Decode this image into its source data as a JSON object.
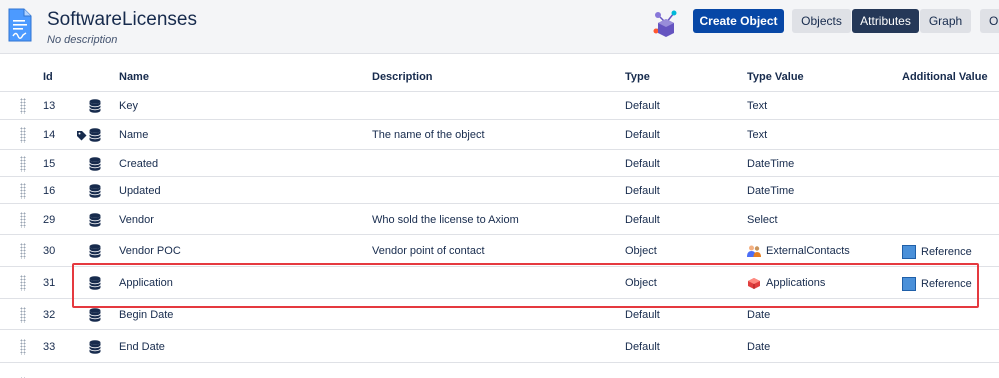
{
  "header": {
    "title": "SoftwareLicenses",
    "subtitle": "No description",
    "create_button": "Create Object",
    "tabs": [
      {
        "label": "Objects",
        "active": false
      },
      {
        "label": "Attributes",
        "active": true
      },
      {
        "label": "Graph",
        "active": false
      },
      {
        "label": "O",
        "active": false
      }
    ]
  },
  "table": {
    "columns": {
      "id": "Id",
      "name": "Name",
      "description": "Description",
      "type": "Type",
      "type_value": "Type Value",
      "additional_value": "Additional Value"
    },
    "rows": [
      {
        "id": "13",
        "name": "Key",
        "description": "",
        "type": "Default",
        "type_value": "Text",
        "additional_value": ""
      },
      {
        "id": "14",
        "name": "Name",
        "description": "The name of the object",
        "type": "Default",
        "type_value": "Text",
        "additional_value": "",
        "label_icon": "tag-icon"
      },
      {
        "id": "15",
        "name": "Created",
        "description": "",
        "type": "Default",
        "type_value": "DateTime",
        "additional_value": ""
      },
      {
        "id": "16",
        "name": "Updated",
        "description": "",
        "type": "Default",
        "type_value": "DateTime",
        "additional_value": ""
      },
      {
        "id": "29",
        "name": "Vendor",
        "description": "Who sold the license to Axiom",
        "type": "Default",
        "type_value": "Select",
        "additional_value": ""
      },
      {
        "id": "30",
        "name": "Vendor POC",
        "description": "Vendor point of contact",
        "type": "Object",
        "type_value": "ExternalContacts",
        "type_value_icon": "contacts-icon",
        "additional_value": "Reference"
      },
      {
        "id": "31",
        "name": "Application",
        "description": "",
        "type": "Object",
        "type_value": "Applications",
        "type_value_icon": "applications-icon",
        "additional_value": "Reference",
        "highlighted": true
      },
      {
        "id": "32",
        "name": "Begin Date",
        "description": "",
        "type": "Default",
        "type_value": "Date",
        "additional_value": ""
      },
      {
        "id": "33",
        "name": "End Date",
        "description": "",
        "type": "Default",
        "type_value": "Date",
        "additional_value": ""
      },
      {
        "id": "34",
        "name": "",
        "description": "",
        "type": "",
        "type_value": "",
        "additional_value": "",
        "partially_visible": true
      }
    ]
  },
  "colors": {
    "primary_button": "#0747a6",
    "active_tab": "#253858",
    "highlight_border": "#e5393f",
    "reference_box": "#4a90d9"
  }
}
